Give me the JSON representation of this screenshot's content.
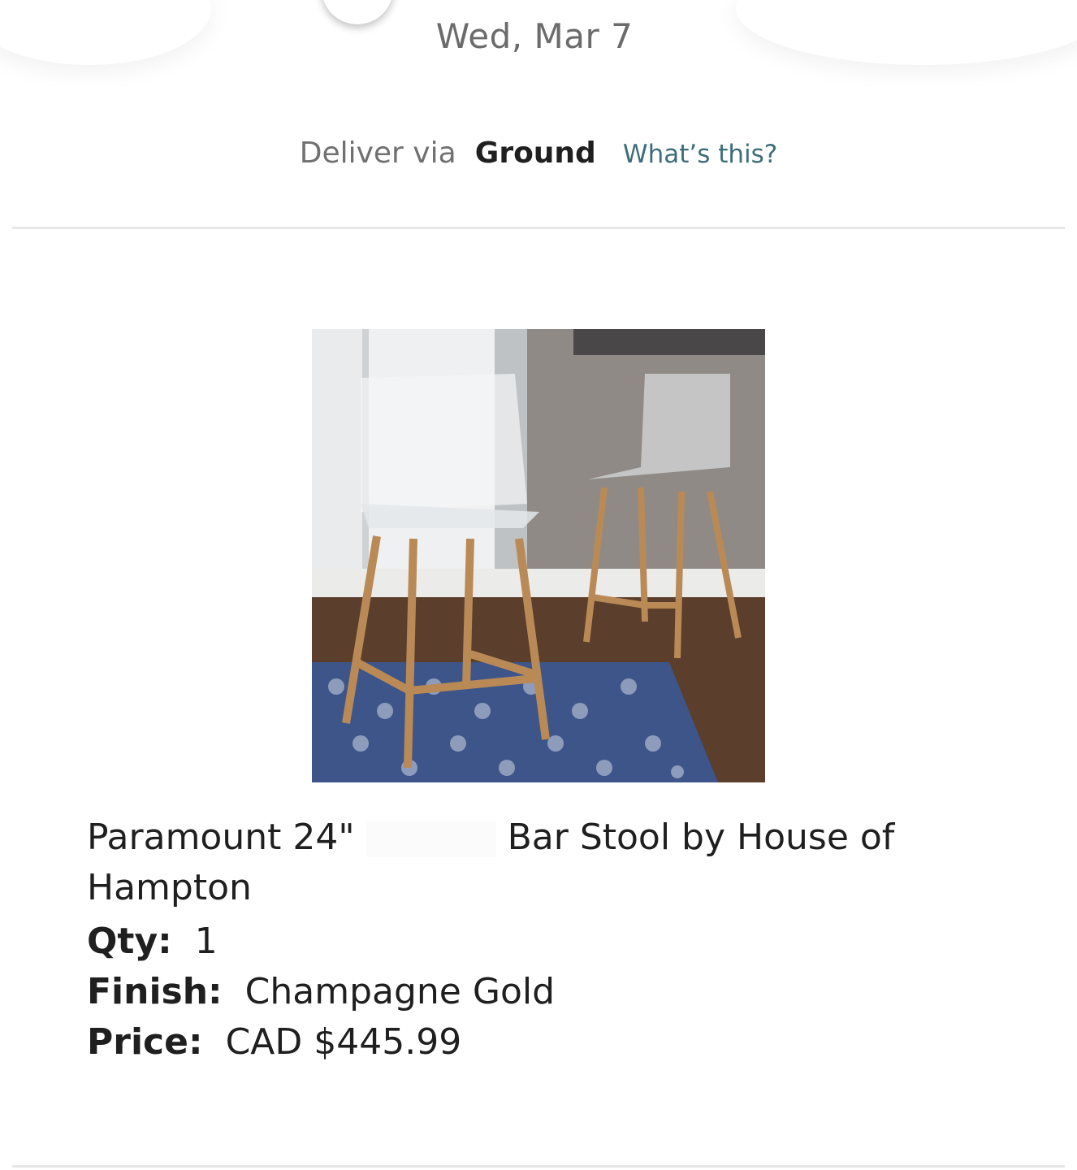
{
  "delivery": {
    "date": "Wed, Mar 7",
    "via_label": "Deliver via",
    "method": "Ground",
    "whats_this": "What’s this?"
  },
  "product": {
    "image_alt": "Two clear acrylic bar stools with champagne gold legs on a blue patterned rug",
    "title_part1": "Paramount 24\"",
    "title_part2": "Bar Stool by House of Hampton",
    "qty_label": "Qty:",
    "qty_value": "1",
    "finish_label": "Finish:",
    "finish_value": "Champagne Gold",
    "price_label": "Price:",
    "price_value": "CAD $445.99"
  },
  "colors": {
    "link": "#3d6d7a",
    "text": "#1f1f1f",
    "muted": "#6b6b6b",
    "divider": "#e6e6e6"
  }
}
